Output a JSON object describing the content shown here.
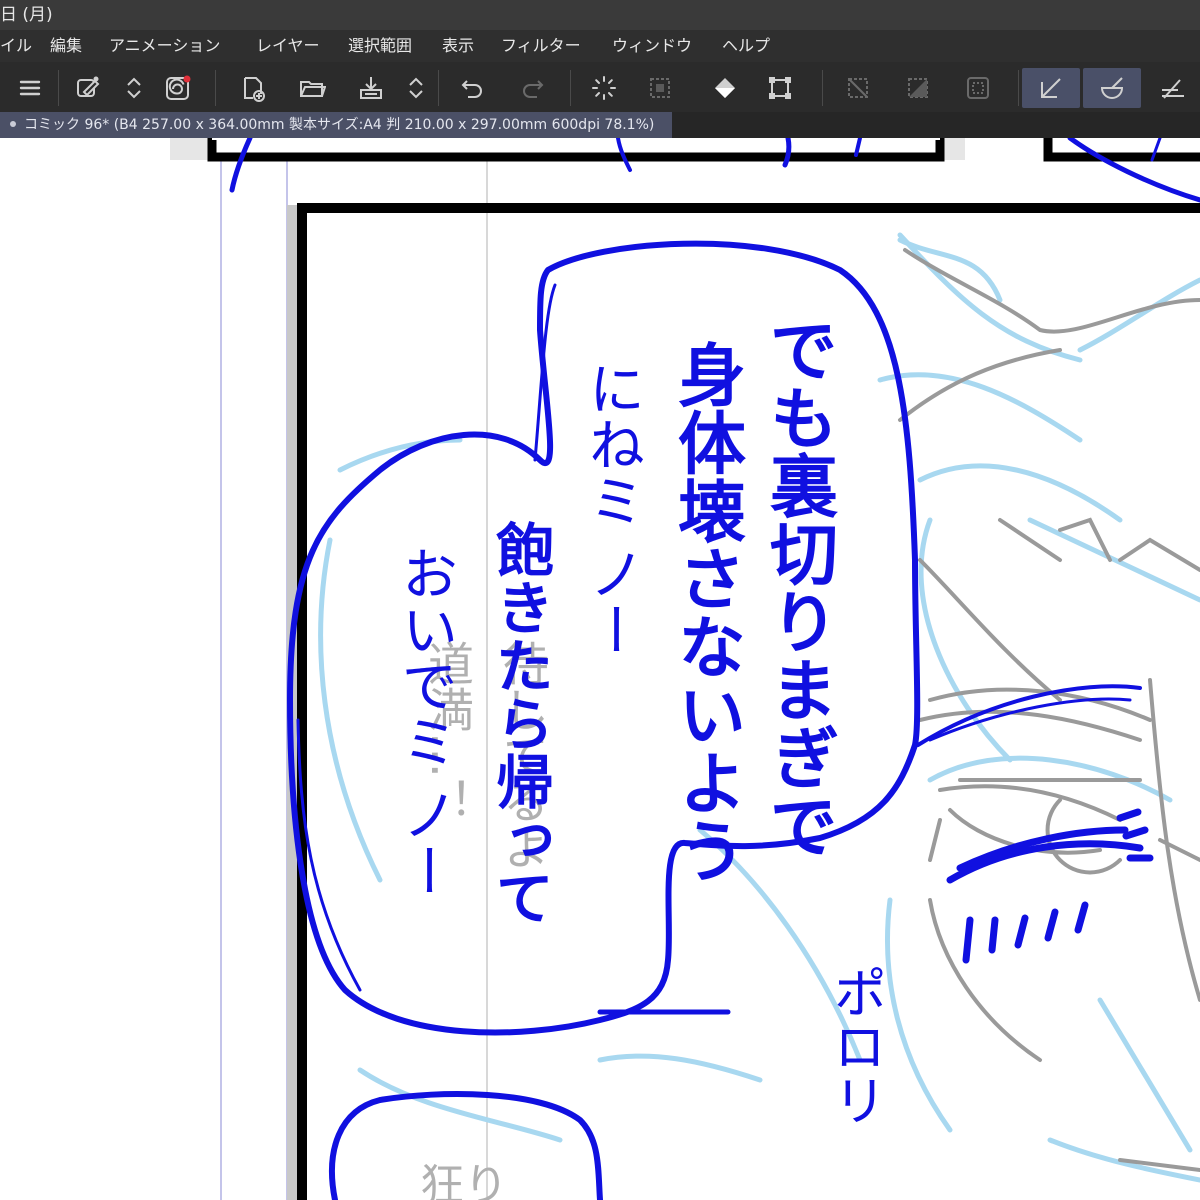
{
  "app": {
    "title_fragment": "日 (月)"
  },
  "menu": {
    "items": [
      "イル",
      "編集",
      "アニメーション",
      "レイヤー",
      "選択範囲",
      "表示",
      "フィルター",
      "ウィンドウ",
      "ヘルプ"
    ]
  },
  "toolbar": {
    "buttons": [
      {
        "icon": "hamburger-menu-icon",
        "active": false
      },
      {
        "icon": "eyedropper-settings-icon",
        "active": false
      },
      {
        "icon": "up-down-arrows-icon",
        "active": false
      },
      {
        "icon": "swirl-notification-icon",
        "active": false
      },
      {
        "icon": "new-document-icon",
        "active": false
      },
      {
        "icon": "open-folder-icon",
        "active": false
      },
      {
        "icon": "save-icon",
        "active": false
      },
      {
        "icon": "up-down-arrows-icon",
        "active": false
      },
      {
        "icon": "undo-icon",
        "active": false
      },
      {
        "icon": "redo-icon",
        "active": false
      },
      {
        "icon": "loading-spinner-icon",
        "active": false
      },
      {
        "icon": "selection-grid-icon",
        "active": false
      },
      {
        "icon": "fill-bucket-icon",
        "active": false
      },
      {
        "icon": "transform-icon",
        "active": false
      },
      {
        "icon": "clear-selection-icon",
        "active": false
      },
      {
        "icon": "invert-selection-icon",
        "active": false
      },
      {
        "icon": "selection-border-icon",
        "active": false
      },
      {
        "icon": "ruler-snap-icon",
        "active": true
      },
      {
        "icon": "special-ruler-snap-icon",
        "active": true
      },
      {
        "icon": "grid-snap-icon",
        "active": false
      }
    ],
    "accent": "#4a5068"
  },
  "document_tab": {
    "label": "コミック 96* (B4 257.00 x 364.00mm 製本サイズ:A4 判 210.00 x 297.00mm 600dpi 78.1%)"
  },
  "canvas": {
    "speech_bubble_text": {
      "line1": "でも裏切りまぎで",
      "line2": "身体壊さないよう",
      "line3": "にねミ ノー",
      "line4": "飽きたら帰って",
      "line5": "おいでミ ノー",
      "sfx": "ポロリ"
    },
    "faint_text": {
      "col1": "道満…！",
      "col2": "待してるよ",
      "bottom": "狂り"
    },
    "colors": {
      "ink_blue": "#1010e0",
      "sketch_blue": "#a8d8f0",
      "sketch_gray": "#9a9a9a",
      "panel_border": "#000000"
    }
  }
}
